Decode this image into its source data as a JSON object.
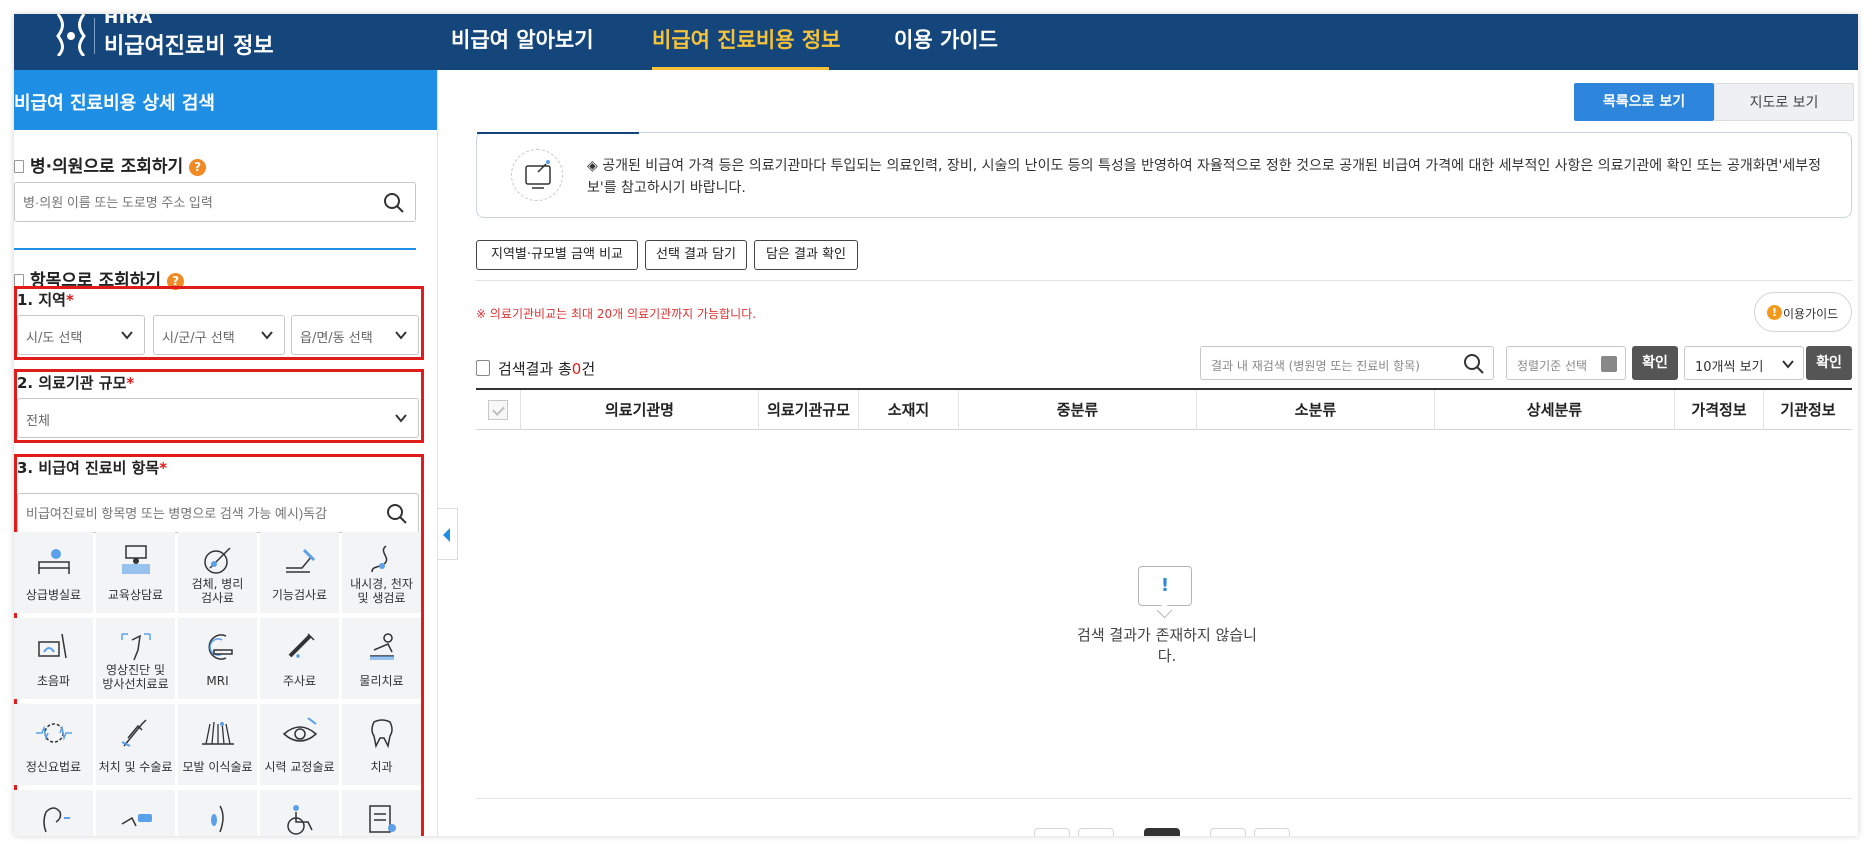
{
  "header": {
    "logo_top": "HIRA",
    "logo_bottom": "비급여진료비 정보",
    "nav": [
      "비급여 알아보기",
      "비급여 진료비용 정보",
      "이용 가이드"
    ]
  },
  "sidebar": {
    "title": "비급여 진료비용 상세 검색",
    "hospital_search": {
      "title": "병·의원으로 조회하기",
      "placeholder": "병·의원 이름 또는 도로명 주소 입력"
    },
    "item_search_title": "항목으로 조회하기",
    "region": {
      "label": "1. 지역",
      "required": "*",
      "selects": [
        "시/도 선택",
        "시/군/구 선택",
        "읍/면/동 선택"
      ]
    },
    "scale": {
      "label": "2. 의료기관 규모",
      "required": "*",
      "value": "전체"
    },
    "items": {
      "label": "3. 비급여 진료비 항목",
      "required": "*",
      "placeholder": "비급여진료비 항목명 또는 병명으로 검색 가능 예시)독감"
    },
    "categories": [
      {
        "label": "상급병실료",
        "icon": "hospital-bed-icon"
      },
      {
        "label": "교육상담료",
        "icon": "counseling-icon"
      },
      {
        "label": "검체, 병리\n검사료",
        "icon": "pathology-test-icon"
      },
      {
        "label": "기능검사료",
        "icon": "function-test-icon"
      },
      {
        "label": "내시경, 천자\n및 생검료",
        "icon": "endoscopy-icon"
      },
      {
        "label": "초음파",
        "icon": "ultrasound-icon"
      },
      {
        "label": "영상진단 및\n방사선치료료",
        "icon": "radiology-icon"
      },
      {
        "label": "MRI",
        "icon": "mri-icon"
      },
      {
        "label": "주사료",
        "icon": "injection-icon"
      },
      {
        "label": "물리치료",
        "icon": "physical-therapy-icon"
      },
      {
        "label": "정신요법료",
        "icon": "psychotherapy-icon"
      },
      {
        "label": "처치 및 수술료",
        "icon": "surgery-icon"
      },
      {
        "label": "모발 이식술료",
        "icon": "hair-transplant-icon"
      },
      {
        "label": "시력 교정술료",
        "icon": "vision-correction-icon"
      },
      {
        "label": "치과",
        "icon": "tooth-icon"
      }
    ]
  },
  "main": {
    "view_list": "목록으로 보기",
    "view_map": "지도로 보기",
    "notice": "◈ 공개된 비급여 가격 등은 의료기관마다 투입되는 의료인력, 장비, 시술의 난이도 등의 특성을 반영하여 자율적으로 정한 것으로 공개된 비급여 가격에 대한 세부적인 사항은 의료기관에 확인 또는 공개화면'세부정보'를 참고하시기 바랍니다.",
    "actions": [
      "지역별·규모별 금액 비교",
      "선택 결과 담기",
      "담은 결과 확인"
    ],
    "compare_note": "※ 의료기관비교는 최대 20개 의료기관까지 가능합니다.",
    "guide": "이용가이드",
    "result_prefix": "검색결과 총",
    "result_count": "0",
    "result_suffix": "건",
    "research_placeholder": "결과 내 재검색 (병원명 또는 진료비 항목)",
    "sort_placeholder": "정렬기준 선택",
    "confirm": "확인",
    "per_page": "10개씩 보기",
    "columns": [
      "의료기관명",
      "의료기관규모",
      "소재지",
      "중분류",
      "소분류",
      "상세분류",
      "가격정보",
      "기관정보"
    ],
    "empty_mark": "!",
    "empty": "검색 결과가 존재하지 않습니다."
  },
  "colors": {
    "header_bg": "#14467b",
    "accent_yellow": "#f6c23a",
    "sidebar_head": "#1f8fe6",
    "highlight_red": "#e21b1b"
  }
}
